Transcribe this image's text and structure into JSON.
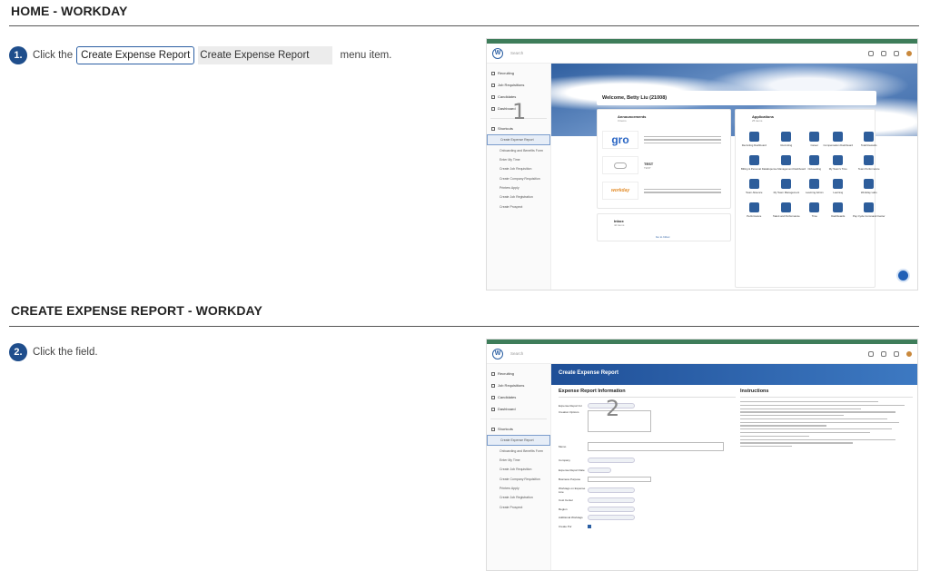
{
  "section1": {
    "title": "HOME - WORKDAY"
  },
  "step1": {
    "number": "1.",
    "prefix": "Click the",
    "outlined_chip": "Create Expense Report",
    "grey_chip": "Create Expense Report",
    "suffix": "menu item."
  },
  "section2": {
    "title": "CREATE EXPENSE REPORT - WORKDAY"
  },
  "step2": {
    "number": "2.",
    "text": "Click the field."
  },
  "shot1": {
    "logo": "W",
    "search_placeholder": "Search",
    "sidebar_items": [
      "Recruiting",
      "Job Requisitions",
      "Candidates",
      "Dashboard"
    ],
    "shortcuts_label": "Shortcuts",
    "shortcuts": [
      "Create Expense Report",
      "Onboarding and Benefits Form",
      "Enter My Time",
      "Create Job Requisition",
      "Create Company Requisition",
      "Printers Apply",
      "Create Job Registration",
      "Create Prospect"
    ],
    "welcome": "Welcome, Betty Liu (21008)",
    "annotation": "1",
    "announcements_title": "Announcements",
    "announcements_count": "3 items",
    "ann_test_title": "TEST",
    "ann_test_sub": "TEST",
    "inbox_title": "Inbox",
    "inbox_sub": "4d items",
    "inbox_link": "Go to Inbox",
    "applications_title": "Applications",
    "applications_count": "25 items",
    "apps": [
      "Recruiting Dashboard",
      "Recruiting",
      "Career",
      "Compensation Dashboard",
      "Total Rewards",
      "Billing & Personal Data",
      "Expense Management Dashboard",
      "Onboarding",
      "My Team's Time",
      "Team Performance",
      "Team Absence",
      "My Team Management",
      "Learning Admin",
      "Learning",
      "Workday Labs",
      "Performance",
      "Talent and Performance",
      "Time",
      "Dashboards",
      "Pay Cycle Command Center"
    ]
  },
  "shot2": {
    "page_header": "Create Expense Report",
    "annotation": "2",
    "info_heading": "Expense Report Information",
    "instructions_heading": "Instructions",
    "fields": [
      "Expense Report for",
      "Creation Options",
      "Memo",
      "Company",
      "Expense Report Date",
      "Business Purpose",
      "Worktags on Expense Line",
      "Cost Center",
      "Region",
      "Additional Worktags",
      "Create Pur"
    ],
    "shortcuts": [
      "Create Expense Report",
      "Onboarding and Benefits Form",
      "Enter My Time",
      "Create Job Requisition",
      "Create Company Requisition",
      "Printers Apply",
      "Create Job Registration",
      "Create Prospect"
    ],
    "sidebar_items": [
      "Recruiting",
      "Job Requisitions",
      "Candidates",
      "Dashboard"
    ],
    "shortcuts_label": "Shortcuts"
  }
}
